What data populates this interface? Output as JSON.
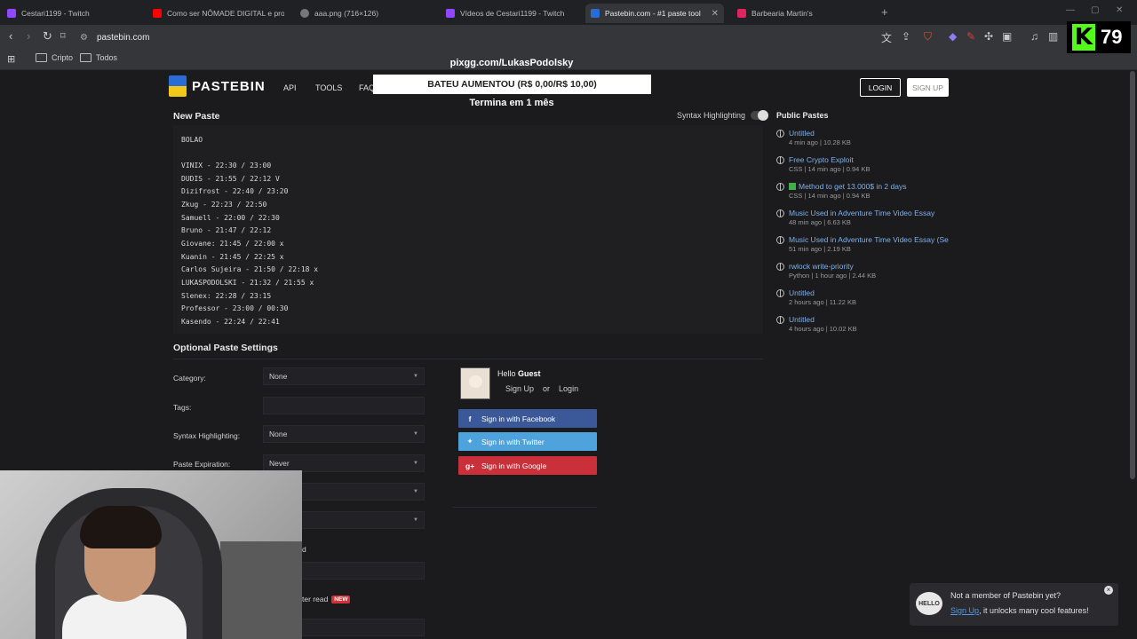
{
  "browser": {
    "tabs": [
      {
        "title": "Cestari1199 - Twitch",
        "color": "#9146ff"
      },
      {
        "title": "Como ser NÔMADE DIGITAL e progr...",
        "color": "#ff0000"
      },
      {
        "title": "aaa.png (716×126)",
        "color": "#777777"
      },
      {
        "title": "Vídeos de Cestari1199 - Twitch",
        "color": "#9146ff"
      },
      {
        "title": "Pastebin.com - #1 paste tool sin...",
        "color": "#2a6cd6",
        "close": "✕"
      },
      {
        "title": "Barbearia Martin's",
        "color": "#e0245e"
      }
    ],
    "new_tab": "+",
    "url": "pastebin.com",
    "bookmarks": [
      "Cripto",
      "Todos"
    ]
  },
  "kick": {
    "count": "79",
    "logo_letter": "K",
    "brand_color": "#53fc18"
  },
  "overlay": {
    "url": "pixgg.com/LukasPodolsky",
    "goal": "BATEU AUMENTOU (R$ 0,00/R$ 10,00)",
    "ends": "Termina em 1 mês"
  },
  "header": {
    "logo": "PASTEBIN",
    "nav": [
      "API",
      "TOOLS",
      "FAQ"
    ],
    "login": "LOGIN",
    "signup": "SIGN UP"
  },
  "paste": {
    "title": "New Paste",
    "syntax_label": "Syntax Highlighting",
    "lines": [
      "BOLAO",
      "",
      "VINIX - 22:30 / 23:00",
      "DUDIS - 21:55 / 22:12 V",
      "Dizifrost - 22:40 / 23:20",
      "Zkug - 22:23 / 22:50",
      "Samuell - 22:00 / 22:30",
      "Bruno - 21:47 / 22:12",
      "Giovane: 21:45 / 22:00 x",
      "Kuanin - 21:45 / 22:25 x",
      "Carlos Sujeira - 21:50 / 22:18 x",
      "LUKASPODOLSKI - 21:32 / 21:55 x",
      "Slenex: 22:28 / 23:15",
      "Professor - 23:00 / 00:30",
      "Kasendo - 22:24 / 22:41"
    ]
  },
  "settings": {
    "title": "Optional Paste Settings",
    "category_label": "Category:",
    "category_value": "None",
    "tags_label": "Tags:",
    "syntax_label": "Syntax Highlighting:",
    "syntax_value": "None",
    "expiration_label": "Paste Expiration:",
    "expiration_value": "Never",
    "partial_1": "d",
    "partial_2": "ter read",
    "new_badge": "NEW"
  },
  "guest": {
    "hello": "Hello",
    "name": "Guest",
    "signup": "Sign Up",
    "or": "or",
    "login": "Login",
    "facebook": "Sign in with Facebook",
    "twitter": "Sign in with Twitter",
    "google": "Sign in with Google"
  },
  "public_pastes": {
    "title": "Public Pastes",
    "items": [
      {
        "name": "Untitled",
        "meta": "4 min ago | 10.28 KB"
      },
      {
        "name": "Free Crypto Exploit",
        "meta": "CSS | 14 min ago | 0.94 KB"
      },
      {
        "name": "Method to get 13.000$ in 2 days",
        "meta": "CSS | 14 min ago | 0.94 KB"
      },
      {
        "name": "Music Used in Adventure Time Video Essay",
        "meta": "48 min ago | 6.63 KB"
      },
      {
        "name": "Music Used in Adventure Time Video Essay (Sea...",
        "meta": "51 min ago | 2.19 KB"
      },
      {
        "name": "rwlock write-priority",
        "meta": "Python | 1 hour ago | 2.44 KB"
      },
      {
        "name": "Untitled",
        "meta": "2 hours ago | 11.22 KB"
      },
      {
        "name": "Untitled",
        "meta": "4 hours ago | 10.02 KB"
      }
    ]
  },
  "toast": {
    "icon_text": "HELLO",
    "question": "Not a member of Pastebin yet?",
    "link": "Sign Up",
    "rest": ", it unlocks many cool features!",
    "close": "×"
  }
}
